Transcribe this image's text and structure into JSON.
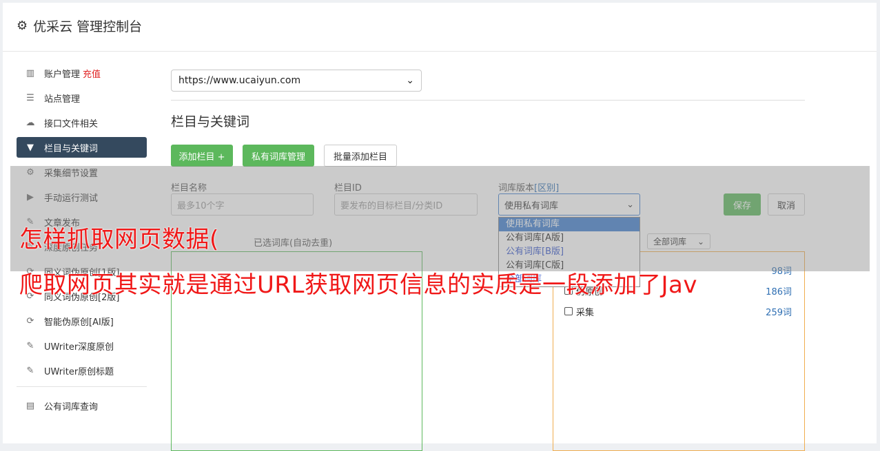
{
  "app": {
    "title": "优采云 管理控制台",
    "icon": "gear-icon"
  },
  "sidebar": {
    "items": [
      {
        "label": "账户管理",
        "extra": "充值",
        "icon": "bar-chart-icon"
      },
      {
        "label": "站点管理",
        "icon": "server-icon"
      },
      {
        "label": "接口文件相关",
        "icon": "cloud-upload-icon"
      },
      {
        "label": "栏目与关键词",
        "icon": "filter-icon",
        "active": true
      },
      {
        "label": "采集细节设置",
        "icon": "cogs-icon"
      },
      {
        "label": "手动运行测试",
        "icon": "play-circle-icon"
      },
      {
        "label": "文章发布",
        "icon": "edit-icon"
      },
      {
        "label": "深度原创任务",
        "icon": "edit-icon"
      },
      {
        "label": "同义词伪原创[1版]",
        "icon": "refresh-icon"
      },
      {
        "label": "同义词伪原创[2版]",
        "icon": "refresh-icon"
      },
      {
        "label": "智能伪原创[AI版]",
        "icon": "refresh-icon"
      },
      {
        "label": "UWriter深度原创",
        "icon": "edit-icon"
      },
      {
        "label": "UWriter原创标题",
        "icon": "edit-icon"
      }
    ],
    "bottom_item": {
      "label": "公有词库查询",
      "icon": "book-icon"
    }
  },
  "main": {
    "site_select": "https://www.ucaiyun.com",
    "section_title": "栏目与关键词",
    "buttons": {
      "add_column": "添加栏目 +",
      "private_lib": "私有词库管理",
      "batch_add": "批量添加栏目"
    },
    "form": {
      "name_label": "栏目名称",
      "name_placeholder": "最多10个字",
      "id_label": "栏目ID",
      "id_placeholder": "要发布的目标栏目/分类ID",
      "version_label": "词库版本",
      "version_link": "[区别]",
      "version_value": "使用私有词库",
      "version_options": [
        "使用私有词库",
        "公有词库[A版]",
        "公有词库[B版]",
        "公有词库[C版]",
        "全部词库"
      ],
      "save": "保存",
      "cancel": "取消"
    },
    "selected_label": "已选词库(自动去重)",
    "filter_value": "全部词库",
    "libraries": [
      {
        "name": "",
        "count": "98词"
      },
      {
        "name": "伪原创",
        "count": "186词"
      },
      {
        "name": "采集",
        "count": "259词"
      }
    ]
  },
  "overlay_caption": {
    "line1": "怎样抓取网页数据(",
    "line2": "爬取网页其实就是通过URL获取网页信息的实质是一段添加了Jav"
  },
  "colors": {
    "active_nav": "#34495e",
    "green": "#5cb85c",
    "orange": "#f0ad4e",
    "caption": "#f01818",
    "recharge": "#e02020"
  }
}
